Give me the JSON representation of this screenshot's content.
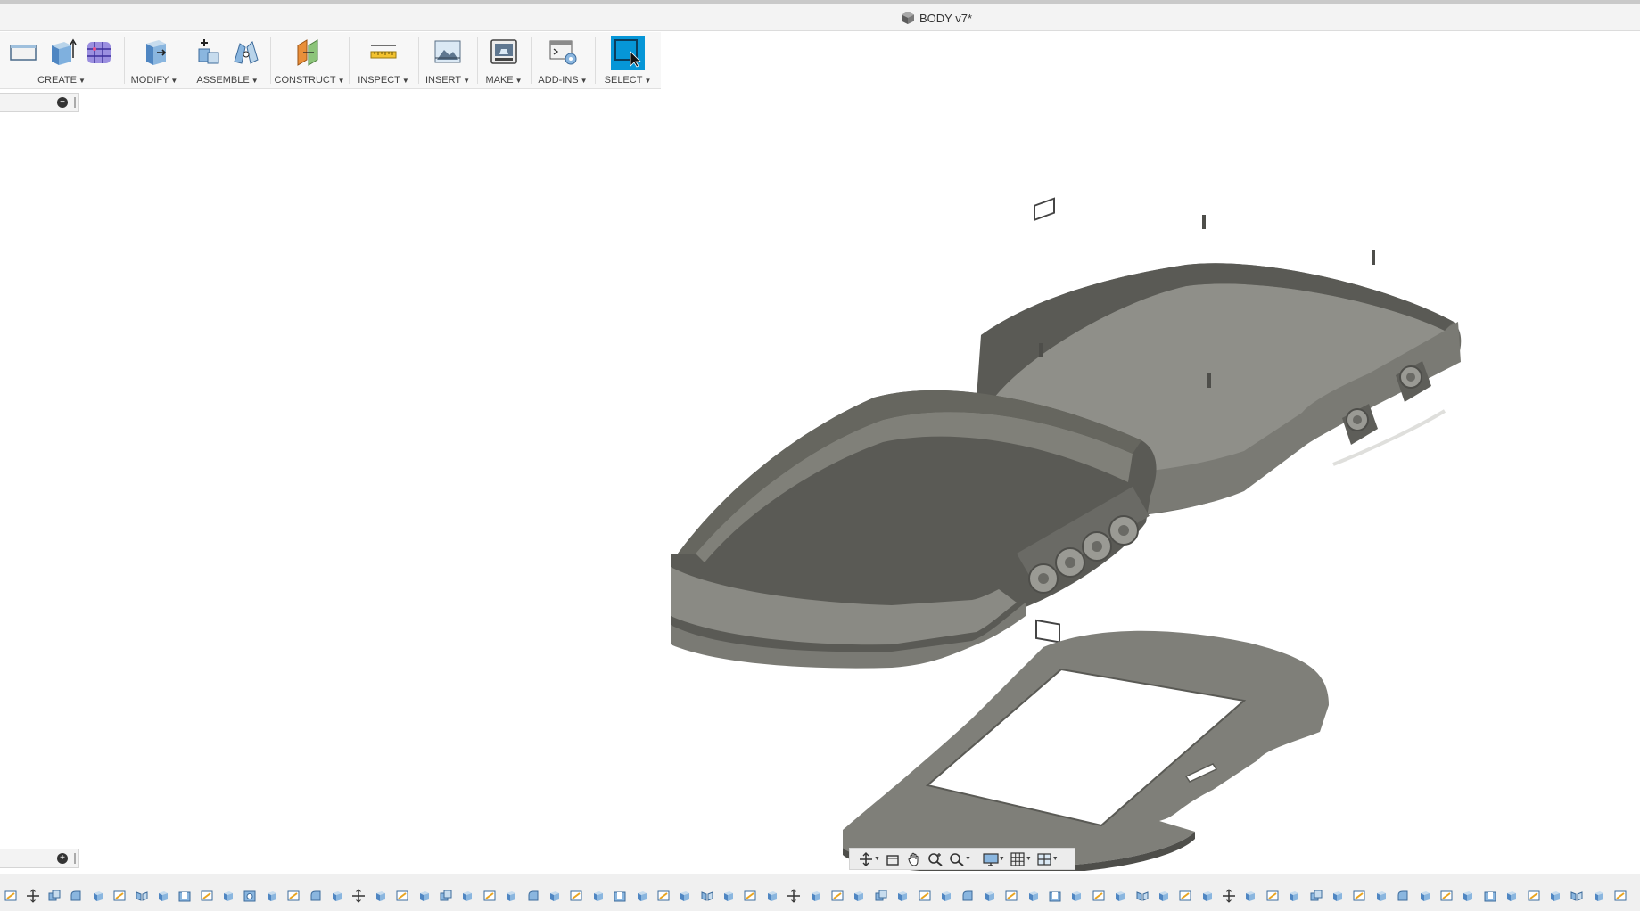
{
  "window": {
    "title": "BODY v7*"
  },
  "toolbar": {
    "groups": [
      {
        "id": "create",
        "label": "CREATE"
      },
      {
        "id": "modify",
        "label": "MODIFY"
      },
      {
        "id": "assemble",
        "label": "ASSEMBLE"
      },
      {
        "id": "construct",
        "label": "CONSTRUCT"
      },
      {
        "id": "inspect",
        "label": "INSPECT"
      },
      {
        "id": "insert",
        "label": "INSERT"
      },
      {
        "id": "make",
        "label": "MAKE"
      },
      {
        "id": "addins",
        "label": "ADD-INS"
      },
      {
        "id": "select",
        "label": "SELECT"
      }
    ],
    "accent_color": "#0696d7"
  },
  "browser_panel": {
    "collapse_symbol": "−"
  },
  "comments_panel": {
    "expand_symbol": "+"
  },
  "navigation_bar": {
    "icons": [
      "orbit-icon",
      "look-at-icon",
      "pan-icon",
      "zoom-icon",
      "fit-icon",
      "display-settings-icon",
      "grid-icon",
      "viewports-icon"
    ]
  },
  "model": {
    "part_color": "#8c8c86",
    "shadow_color": "#5e5e59"
  },
  "timeline": {
    "feature_types": [
      "sketch",
      "extrude",
      "move",
      "fillet",
      "combine",
      "mirror",
      "shell",
      "hole"
    ]
  }
}
